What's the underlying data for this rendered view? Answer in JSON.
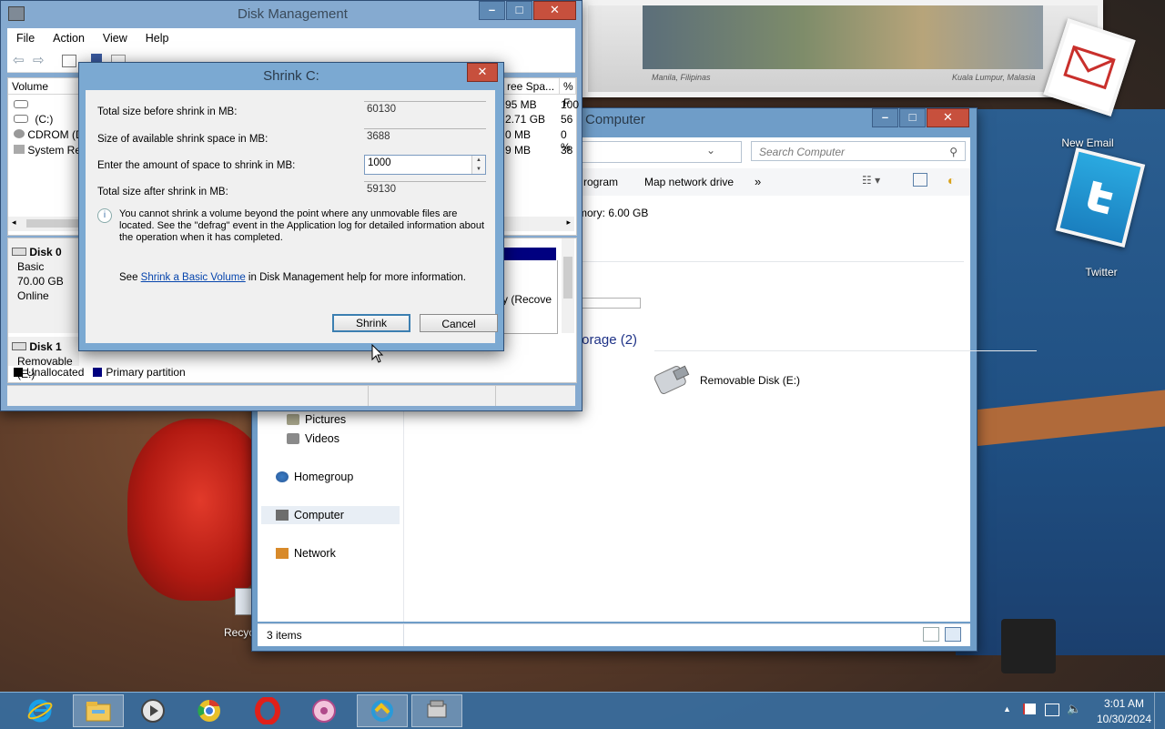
{
  "desktop": {
    "photo_captions": [
      "Manila, Filipinas",
      "Kuala Lumpur, Malasia"
    ],
    "icons": [
      {
        "label": "New Email",
        "icon": "email-icon"
      },
      {
        "label": "Twitter",
        "icon": "twitter-icon"
      }
    ],
    "recycle_label": "Recyc"
  },
  "disk_management": {
    "title": "Disk Management",
    "menu": [
      "File",
      "Action",
      "View",
      "Help"
    ],
    "columns": [
      "Volume",
      "ree Spa...",
      "% F"
    ],
    "volumes": [
      {
        "name": "",
        "free": "95 MB",
        "pct": "100"
      },
      {
        "name": "(C:)",
        "free": "2.71 GB",
        "pct": "56"
      },
      {
        "name": "CDROM (D",
        "free": "0 MB",
        "pct": "0 %"
      },
      {
        "name": "System Re",
        "free": "9 MB",
        "pct": "38"
      }
    ],
    "disks": [
      {
        "name": "Disk 0",
        "lines": [
          "Basic",
          "70.00 GB",
          "Online"
        ]
      },
      {
        "name": "Disk 1",
        "lines": [
          "Removable (E:)"
        ]
      }
    ],
    "partition_fragment": "y (Recove",
    "legend": [
      {
        "label": "Unallocated",
        "color": "#000000"
      },
      {
        "label": "Primary partition",
        "color": "#000080"
      }
    ]
  },
  "dialog": {
    "title": "Shrink C:",
    "rows": [
      {
        "label": "Total size before shrink in MB:",
        "value": "60130"
      },
      {
        "label": "Size of available shrink space in MB:",
        "value": "3688"
      },
      {
        "label": "Enter the amount of space to shrink in MB:",
        "value": "1000"
      },
      {
        "label": "Total size after shrink in MB:",
        "value": "59130"
      }
    ],
    "info_text": "You cannot shrink a volume beyond the point where any unmovable files are located. See the \"defrag\" event in the Application log for detailed information about the operation when it has completed.",
    "help_prefix": "See ",
    "help_link": "Shrink a Basic Volume",
    "help_suffix": " in Disk Management help for more information.",
    "shrink_label": "Shrink",
    "cancel_label": "Cancel"
  },
  "explorer": {
    "title": "Computer",
    "search_placeholder": "Search Computer",
    "commands": [
      "rogram",
      "Map network drive",
      "»"
    ],
    "memory_text": "mory:  6.00 GB",
    "section_title": "torage (2)",
    "drive_label": "Removable Disk (E:)",
    "nav": [
      "Pictures",
      "Videos",
      "Homegroup",
      "Computer",
      "Network"
    ],
    "status": "3 items"
  },
  "taskbar": {
    "apps": [
      "internet-explorer-icon",
      "file-explorer-icon",
      "media-player-icon",
      "chrome-icon",
      "opera-icon",
      "flower-app-icon",
      "connect-app-icon",
      "disk-manager-icon"
    ],
    "time": "3:01 AM",
    "date": "10/30/2024"
  }
}
